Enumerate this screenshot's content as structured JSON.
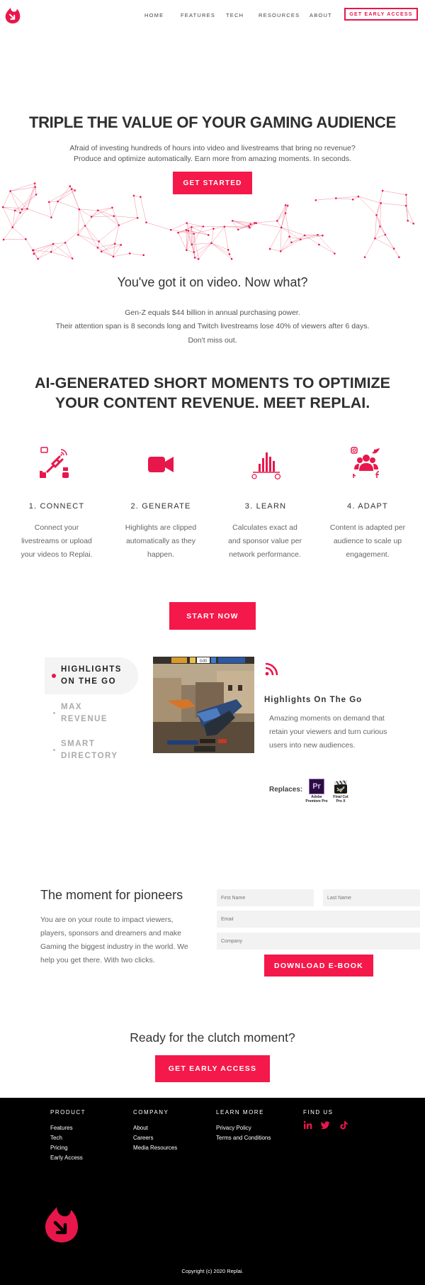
{
  "nav": {
    "links": [
      "HOME",
      "FEATURES",
      "TECH",
      "RESOURCES",
      "ABOUT"
    ],
    "cta": "GET EARLY ACCESS"
  },
  "hero": {
    "title": "TRIPLE THE VALUE OF YOUR GAMING AUDIENCE",
    "sub1": "Afraid of investing hundreds of hours into video and livestreams that bring no revenue?",
    "sub2": "Produce and optimize automatically. Earn more from amazing moments. In seconds.",
    "button": "GET STARTED"
  },
  "video": {
    "title": "You've got it on video. Now what?",
    "p1": "Gen-Z equals $44 billion in annual purchasing power.",
    "p2": "Their attention span is 8 seconds long and Twitch livestreams lose 40% of viewers after 6 days.",
    "p3": "Don't miss out."
  },
  "ai": {
    "line1": "AI-GENERATED SHORT MOMENTS TO OPTIMIZE",
    "line2": "YOUR CONTENT REVENUE. MEET REPLAI."
  },
  "steps": [
    {
      "title": "1. CONNECT",
      "desc": "Connect your livestreams or upload your videos to Replai."
    },
    {
      "title": "2. GENERATE",
      "desc": "Highlights are clipped automatically as they happen."
    },
    {
      "title": "3. LEARN",
      "desc": "Calculates exact ad and sponsor value per network performance."
    },
    {
      "title": "4. ADAPT",
      "desc": "Content is adapted per audience to scale up engagement."
    }
  ],
  "start_button": "START NOW",
  "features": {
    "tabs": [
      {
        "l1": "HIGHLIGHTS",
        "l2": "ON THE GO"
      },
      {
        "l1": "MAX",
        "l2": "REVENUE"
      },
      {
        "l1": "SMART",
        "l2": "DIRECTORY"
      }
    ],
    "head": "Highlights On The Go",
    "desc": "Amazing moments on demand that retain your viewers and turn curious users into new audiences.",
    "replaces": "Replaces:",
    "apps": [
      {
        "glyph": "Pr",
        "label1": "Adobe",
        "label2": "Premiere Pro"
      },
      {
        "glyph": "",
        "label1": "Final Cut",
        "label2": "Pro X"
      }
    ],
    "hud": {
      "score": "0-00",
      "left_team": "",
      "right_team": ""
    }
  },
  "pioneers": {
    "title": "The moment for pioneers",
    "desc": "You are on your route to impact viewers, players, sponsors and dreamers and make Gaming the biggest industry in the world. We help you get there. With two clicks.",
    "first_name": "First Name",
    "last_name": "Last Name",
    "email": "Email",
    "company": "Company",
    "button": "DOWNLOAD E-BOOK"
  },
  "clutch": {
    "title": "Ready for the clutch moment?",
    "button": "GET EARLY ACCESS"
  },
  "footer": {
    "product": {
      "head": "PRODUCT",
      "items": [
        "Features",
        "Tech",
        "Pricing",
        "Early Access"
      ]
    },
    "company": {
      "head": "COMPANY",
      "items": [
        "About",
        "Careers",
        "Media Resources"
      ]
    },
    "learn": {
      "head": "LEARN MORE",
      "items": [
        "Privacy Policy",
        "Terms and Conditions"
      ]
    },
    "find": {
      "head": "FIND US",
      "icons": [
        "linkedin-icon",
        "twitter-icon",
        "tiktok-icon"
      ]
    },
    "copyright": "Copyright (c) 2020 Replai."
  },
  "colors": {
    "accent": "#f5184a",
    "footer_bg": "#000000"
  }
}
